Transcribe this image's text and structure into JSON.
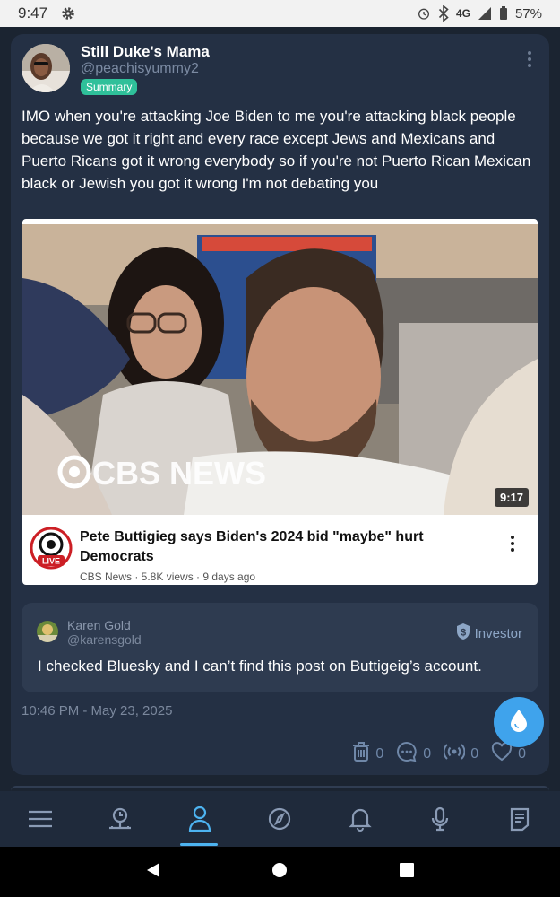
{
  "status_bar": {
    "time": "9:47",
    "network": "4G",
    "battery": "57%",
    "icons": [
      "gear-icon",
      "alarm-icon",
      "bluetooth-icon",
      "signal-icon",
      "battery-icon"
    ]
  },
  "post": {
    "display_name": "Still Duke's Mama",
    "handle": "@peachisyummy2",
    "badge": "Summary",
    "text": "IMO when you're attacking Joe Biden to me you're attacking black people because we got it right and every race except Jews and Mexicans and Puerto Ricans got it wrong everybody so if you're not Puerto Rican Mexican black or Jewish you got it wrong I'm not debating you",
    "timestamp": "10:46 PM - May 23, 2025",
    "video": {
      "thumbnail_watermark": "CBS NEWS",
      "duration": "9:17",
      "channel_badge": "LIVE",
      "title": "Pete Buttigieg says Biden's 2024 bid \"maybe\" hurt Democrats",
      "meta": "CBS News · 5.8K views · 9 days ago"
    },
    "community_note": {
      "name": "Karen Gold",
      "handle": "@karensgold",
      "role": "Investor",
      "text": "I checked Bluesky and I can’t find this post on Buttigeig’s account."
    },
    "actions": {
      "delete_count": "0",
      "comment_count": "0",
      "broadcast_count": "0",
      "like_count": "0"
    }
  },
  "bottom_nav": {
    "items": [
      "menu-icon",
      "pin-icon",
      "profile-icon",
      "compass-icon",
      "bell-icon",
      "microphone-icon",
      "notes-icon"
    ],
    "active": "profile-icon"
  },
  "colors": {
    "background": "#1b2431",
    "card": "#243044",
    "accent": "#3fa3ec",
    "badge": "#2fc09a"
  }
}
